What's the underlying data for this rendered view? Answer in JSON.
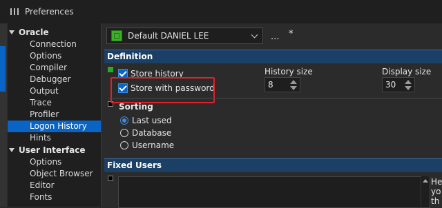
{
  "window": {
    "title": "Preferences",
    "title_icon": "preferences-icon"
  },
  "sidebar": {
    "groups": [
      {
        "label": "Oracle",
        "items": [
          {
            "label": "Connection"
          },
          {
            "label": "Options"
          },
          {
            "label": "Compiler"
          },
          {
            "label": "Debugger"
          },
          {
            "label": "Output"
          },
          {
            "label": "Trace"
          },
          {
            "label": "Profiler"
          },
          {
            "label": "Logon History",
            "selected": true
          },
          {
            "label": "Hints"
          }
        ]
      },
      {
        "label": "User Interface",
        "items": [
          {
            "label": "Options"
          },
          {
            "label": "Object Browser"
          },
          {
            "label": "Editor"
          },
          {
            "label": "Fonts"
          }
        ]
      }
    ]
  },
  "profile": {
    "selected": "Default DANIEL LEE",
    "more_label": "...",
    "modified_marker": "*"
  },
  "definition": {
    "header": "Definition",
    "store_history": {
      "label": "Store history",
      "checked": true
    },
    "store_with_password": {
      "label": "Store with password",
      "checked": true
    },
    "history_size": {
      "label": "History size",
      "value": "8"
    },
    "display_size": {
      "label": "Display size",
      "value": "30"
    },
    "sorting": {
      "label": "Sorting",
      "options": [
        {
          "label": "Last used",
          "selected": true
        },
        {
          "label": "Database",
          "selected": false
        },
        {
          "label": "Username",
          "selected": false
        }
      ]
    }
  },
  "fixed_users": {
    "header": "Fixed Users",
    "hint_lines": [
      "He",
      "yo",
      "th"
    ]
  },
  "colors": {
    "accent": "#0a64c6",
    "section_header": "#1c3f66",
    "highlight": "#e0202a"
  }
}
